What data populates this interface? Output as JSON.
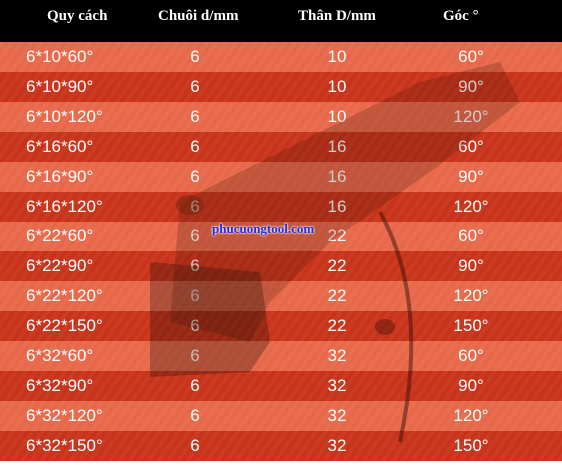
{
  "headers": [
    "Quy cách",
    "Chuôi d/mm",
    "Thân D/mm",
    "Góc °"
  ],
  "rows": [
    [
      "6*10*60°",
      "6",
      "10",
      "60°"
    ],
    [
      "6*10*90°",
      "6",
      "10",
      "90°"
    ],
    [
      "6*10*120°",
      "6",
      "10",
      "120°"
    ],
    [
      "6*16*60°",
      "6",
      "16",
      "60°"
    ],
    [
      "6*16*90°",
      "6",
      "16",
      "90°"
    ],
    [
      "6*16*120°",
      "6",
      "16",
      "120°"
    ],
    [
      "6*22*60°",
      "6",
      "22",
      "60°"
    ],
    [
      "6*22*90°",
      "6",
      "22",
      "90°"
    ],
    [
      "6*22*120°",
      "6",
      "22",
      "120°"
    ],
    [
      "6*22*150°",
      "6",
      "22",
      "150°"
    ],
    [
      "6*32*60°",
      "6",
      "32",
      "60°"
    ],
    [
      "6*32*90°",
      "6",
      "32",
      "90°"
    ],
    [
      "6*32*120°",
      "6",
      "32",
      "120°"
    ],
    [
      "6*32*150°",
      "6",
      "32",
      "150°"
    ]
  ],
  "watermark": "phucuongtool.com",
  "colors": {
    "header_bg": "#000000",
    "row_light": "#e8684a",
    "row_dark": "#c8331a",
    "watermark": "#2b2bd8"
  }
}
